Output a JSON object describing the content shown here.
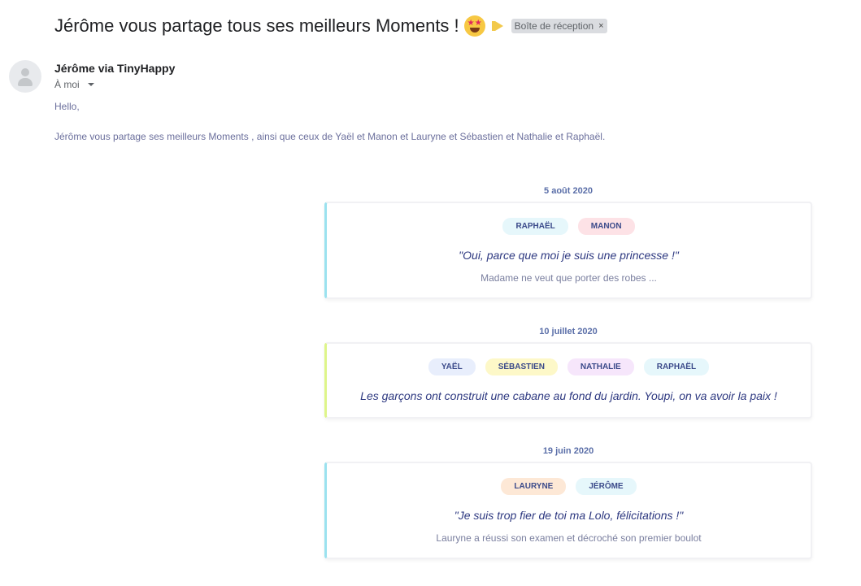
{
  "email": {
    "subject": "Jérôme vous partage tous ses meilleurs Moments !",
    "emoji_icon": "star-struck-emoji-icon",
    "importance_icon": "importance-marker-icon",
    "label": "Boîte de réception",
    "label_remove": "×",
    "sender": "Jérôme via TinyHappy",
    "recipient": "À moi",
    "greeting": "Hello,",
    "intro": "Jérôme vous partage ses meilleurs Moments , ainsi que ceux de Yaël et Manon et Lauryne et Sébastien et Nathalie et Raphaël."
  },
  "moments": [
    {
      "date": "5 août 2020",
      "accent": "#9be2ef",
      "tags": [
        {
          "name": "RAPHAËL",
          "color": "#e6f7fb"
        },
        {
          "name": "MANON",
          "color": "#fde2e6"
        }
      ],
      "quote": "\"Oui, parce que moi je suis une princesse !\"",
      "description": "Madame ne veut que porter des robes ..."
    },
    {
      "date": "10 juillet 2020",
      "accent": "#def58a",
      "tags": [
        {
          "name": "YAËL",
          "color": "#e8eefc"
        },
        {
          "name": "SÉBASTIEN",
          "color": "#fdf8c8"
        },
        {
          "name": "NATHALIE",
          "color": "#f6e6fb"
        },
        {
          "name": "RAPHAËL",
          "color": "#e6f7fb"
        }
      ],
      "quote": "Les garçons ont construit une cabane au fond du jardin. Youpi, on va avoir la paix !",
      "description": ""
    },
    {
      "date": "19 juin 2020",
      "accent": "#9be2ef",
      "tags": [
        {
          "name": "LAURYNE",
          "color": "#fde8d6"
        },
        {
          "name": "JÉRÔME",
          "color": "#e6f7fb"
        }
      ],
      "quote": "\"Je suis trop fier de toi ma Lolo, félicitations !\"",
      "description": "Lauryne a réussi son examen et décroché son premier boulot"
    }
  ]
}
